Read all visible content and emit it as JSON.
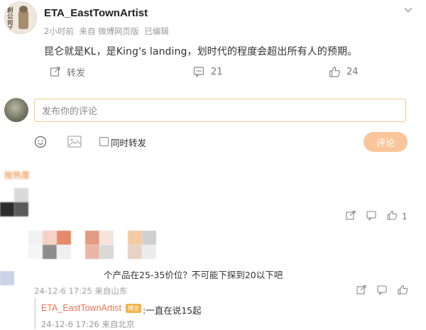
{
  "post": {
    "author": "ETA_EastTownArtist",
    "avatar_text": "刹公司了",
    "time": "2小时前",
    "source": "来自 微博网页版",
    "edited": "已编辑",
    "text": "昆仑就是KL，是King's landing，划时代的程度会超出所有人的预期。",
    "actions": {
      "repost_label": "转发",
      "comment_count": "21",
      "like_count": "24"
    }
  },
  "composer": {
    "placeholder": "发布你的评论",
    "repost_checkbox_label": "同时转发",
    "submit_label": "评论"
  },
  "comments": {
    "sort_label": "按热度",
    "items": [
      {
        "like_count": "1"
      },
      {
        "text": "个产品在25-35价位？不可能下探到20以下吧",
        "meta": "24-12-6 17:25 来自山东",
        "reply": {
          "user": "ETA_EastTownArtist",
          "badge": "博主",
          "text": ":一直在说15起",
          "meta": "24-12-6 17:26 来自北京"
        }
      }
    ]
  },
  "colors": {
    "accent": "#eb7350",
    "input_border": "#f5c88a",
    "submit_bg": "#f9c59a"
  }
}
